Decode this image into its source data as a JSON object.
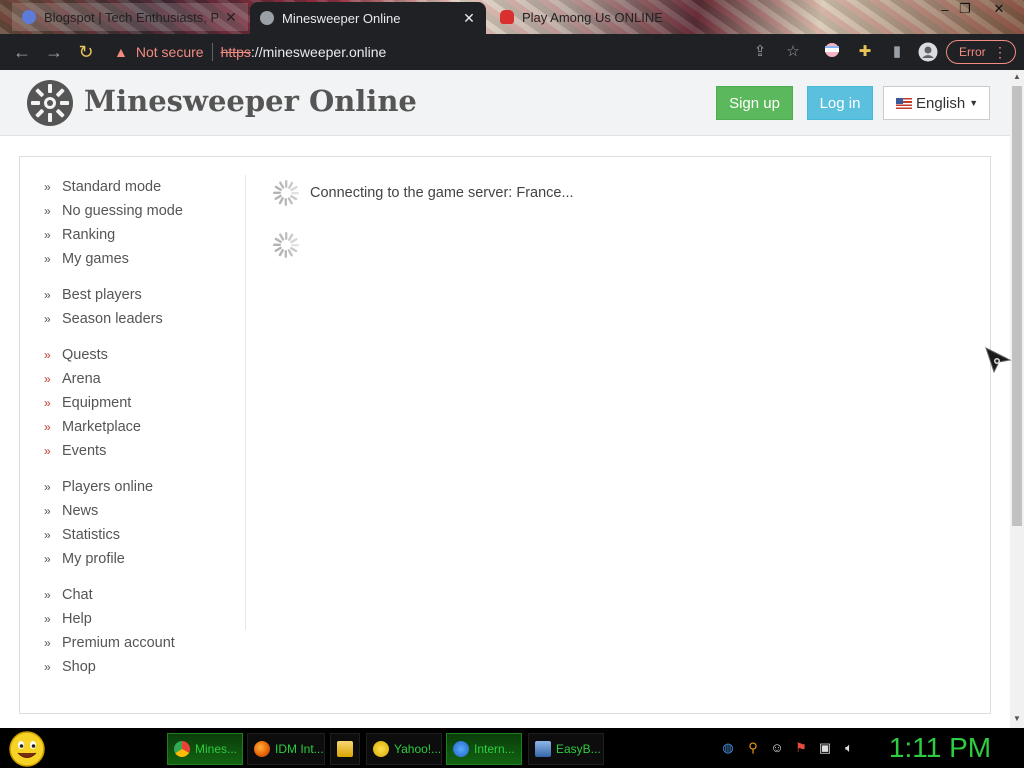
{
  "browser": {
    "tabs": [
      {
        "title": "Blogspot | Tech Enthusiasts, Po...",
        "close": "✕"
      },
      {
        "title": "Minesweeper Online",
        "close": "✕"
      },
      {
        "title": "Play Among Us ONLINE",
        "close": ""
      }
    ],
    "window_controls": {
      "minimize": "–",
      "restore": "❐",
      "close": "✕"
    },
    "nav": {
      "back": "←",
      "forward": "→",
      "reload": "↻"
    },
    "address": {
      "security_label": "Not secure",
      "scheme": "https",
      "rest": "://minesweeper.online"
    },
    "error_label": "Error"
  },
  "header": {
    "title": "Minesweeper Online",
    "signup_label": "Sign up",
    "login_label": "Log in",
    "language_label": "English"
  },
  "sidebar": {
    "groups": [
      [
        {
          "label": "Standard mode"
        },
        {
          "label": "No guessing mode"
        },
        {
          "label": "Ranking"
        },
        {
          "label": "My games"
        }
      ],
      [
        {
          "label": "Best players"
        },
        {
          "label": "Season leaders"
        }
      ],
      [
        {
          "label": "Quests"
        },
        {
          "label": "Arena"
        },
        {
          "label": "Equipment"
        },
        {
          "label": "Marketplace"
        },
        {
          "label": "Events"
        }
      ],
      [
        {
          "label": "Players online"
        },
        {
          "label": "News"
        },
        {
          "label": "Statistics"
        },
        {
          "label": "My profile"
        }
      ],
      [
        {
          "label": "Chat"
        },
        {
          "label": "Help"
        },
        {
          "label": "Premium account"
        },
        {
          "label": "Shop"
        }
      ]
    ]
  },
  "main": {
    "loading_text": "Connecting to the game server: France..."
  },
  "taskbar": {
    "items": [
      {
        "label": "Mines...",
        "icon": "chrome-icon",
        "active": true
      },
      {
        "label": "IDM Int...",
        "icon": "firefox-icon",
        "active": false
      },
      {
        "label": "",
        "icon": "folder-icon",
        "active": false
      },
      {
        "label": "Yahoo!...",
        "icon": "yahoo-messenger-icon",
        "active": false
      },
      {
        "label": "Intern...",
        "icon": "internet-explorer-icon",
        "active": true
      },
      {
        "label": "EasyB...",
        "icon": "easybcd-icon",
        "active": false
      }
    ],
    "clock": "1:11 PM"
  },
  "colors": {
    "signup": "#5cb85c",
    "login": "#5bc0de",
    "not_secure": "#f28b82",
    "chevron_red": "#c0392b",
    "taskbar_text": "#2ecc40"
  }
}
